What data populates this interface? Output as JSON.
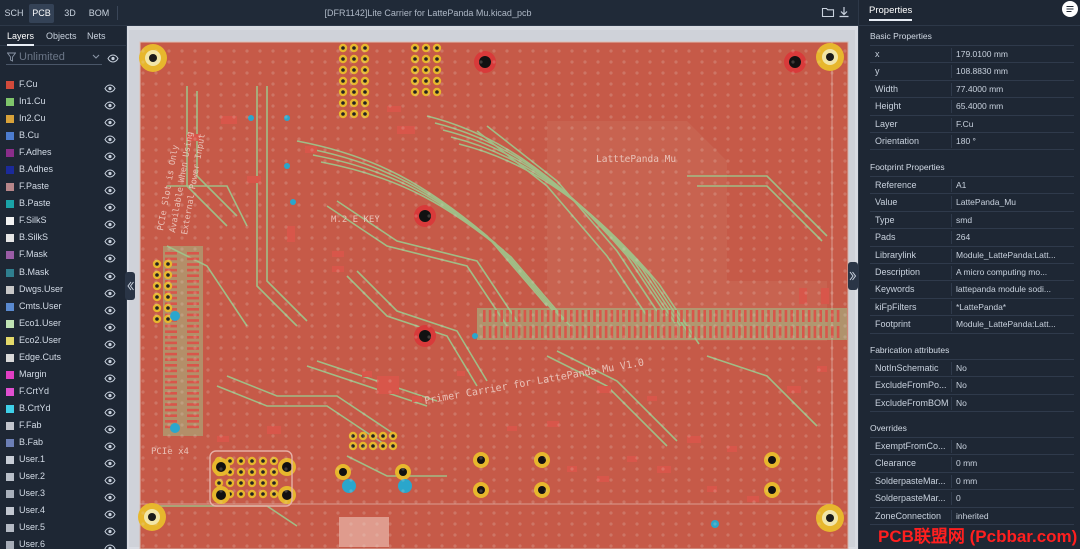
{
  "view_tabs": [
    "SCH",
    "PCB",
    "3D",
    "BOM"
  ],
  "document_title": "[DFR1142]Lite Carrier for LattePanda Mu.kicad_pcb",
  "left_tabs": [
    "Layers",
    "Objects",
    "Nets"
  ],
  "filter_placeholder": "Unlimited",
  "layers": [
    {
      "name": "F.Cu",
      "color": "#d24a3b"
    },
    {
      "name": "In1.Cu",
      "color": "#7fc56b"
    },
    {
      "name": "In2.Cu",
      "color": "#d8a23a"
    },
    {
      "name": "B.Cu",
      "color": "#4c7ccf"
    },
    {
      "name": "F.Adhes",
      "color": "#8a2d8a"
    },
    {
      "name": "B.Adhes",
      "color": "#1b2a9a"
    },
    {
      "name": "F.Paste",
      "color": "#b7868a"
    },
    {
      "name": "B.Paste",
      "color": "#1aa3a8"
    },
    {
      "name": "F.SilkS",
      "color": "#f2f2f2"
    },
    {
      "name": "B.SilkS",
      "color": "#e6e6e6"
    },
    {
      "name": "F.Mask",
      "color": "#9a5ca6"
    },
    {
      "name": "B.Mask",
      "color": "#2f7f8f"
    },
    {
      "name": "Dwgs.User",
      "color": "#c8c8c8"
    },
    {
      "name": "Cmts.User",
      "color": "#5a8ad0"
    },
    {
      "name": "Eco1.User",
      "color": "#bfe3b4"
    },
    {
      "name": "Eco2.User",
      "color": "#e3d96a"
    },
    {
      "name": "Edge.Cuts",
      "color": "#d9d9d9"
    },
    {
      "name": "Margin",
      "color": "#e23ec4"
    },
    {
      "name": "F.CrtYd",
      "color": "#e04fd0"
    },
    {
      "name": "B.CrtYd",
      "color": "#3fd0e8"
    },
    {
      "name": "F.Fab",
      "color": "#c2c5cc"
    },
    {
      "name": "B.Fab",
      "color": "#6c7fb6"
    },
    {
      "name": "User.1",
      "color": "#c8cdd6"
    },
    {
      "name": "User.2",
      "color": "#b8bfc9"
    },
    {
      "name": "User.3",
      "color": "#a9b0bb"
    },
    {
      "name": "User.4",
      "color": "#c2c7d0"
    },
    {
      "name": "User.5",
      "color": "#b4bac4"
    },
    {
      "name": "User.6",
      "color": "#a6acb7"
    }
  ],
  "properties_title": "Properties",
  "sections": [
    {
      "title": "Basic Properties",
      "rows": [
        {
          "key": "x",
          "value": "179.0100 mm"
        },
        {
          "key": "y",
          "value": "108.8830 mm"
        },
        {
          "key": "Width",
          "value": "77.4000 mm"
        },
        {
          "key": "Height",
          "value": "65.4000 mm"
        },
        {
          "key": "Layer",
          "value": "F.Cu"
        },
        {
          "key": "Orientation",
          "value": "180 °"
        }
      ]
    },
    {
      "title": "Footprint Properties",
      "rows": [
        {
          "key": "Reference",
          "value": "A1"
        },
        {
          "key": "Value",
          "value": "LattePanda_Mu"
        },
        {
          "key": "Type",
          "value": "smd"
        },
        {
          "key": "Pads",
          "value": "264"
        },
        {
          "key": "Librarylink",
          "value": "Module_LattePanda:Latt..."
        },
        {
          "key": "Description",
          "value": "A micro computing mo..."
        },
        {
          "key": "Keywords",
          "value": "lattepanda module sodi..."
        },
        {
          "key": "kiFpFilters",
          "value": "*LattePanda*"
        },
        {
          "key": "Footprint",
          "value": "Module_LattePanda:Latt..."
        }
      ]
    },
    {
      "title": "Fabrication attributes",
      "rows": [
        {
          "key": "NotInSchematic",
          "value": "No"
        },
        {
          "key": "ExcludeFromPo...",
          "value": "No"
        },
        {
          "key": "ExcludeFromBOM",
          "value": "No"
        }
      ]
    },
    {
      "title": "Overrides",
      "rows": [
        {
          "key": "ExemptFromCo...",
          "value": "No"
        },
        {
          "key": "Clearance",
          "value": "0 mm"
        },
        {
          "key": "SolderpasteMar...",
          "value": "0 mm"
        },
        {
          "key": "SolderpasteMar...",
          "value": "0"
        },
        {
          "key": "ZoneConnection",
          "value": "inherited"
        }
      ]
    }
  ],
  "pcb_labels": {
    "module_name": "LatttePanda Mu",
    "m2_key": "M.2 E KEY",
    "carrier_title": "Primer Carrier for LattePanda Mu V1.0",
    "pcie": "PCIe x4",
    "slot_note_1": "PCIe Slot is Only",
    "slot_note_2": "Available When Using",
    "slot_note_3": "External Power Input"
  },
  "watermark": "PCB联盟网 (Pcbbar.com)"
}
